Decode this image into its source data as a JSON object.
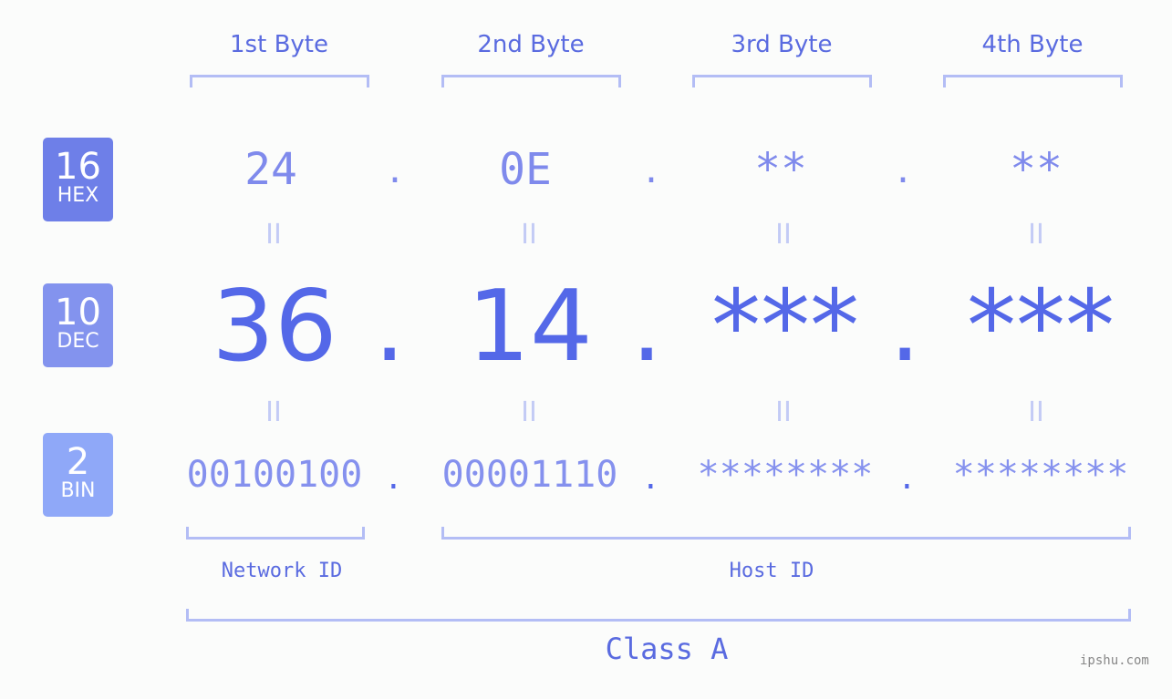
{
  "bytes": [
    {
      "header": "1st Byte",
      "hex": "24",
      "dec": "36",
      "bin": "00100100"
    },
    {
      "header": "2nd Byte",
      "hex": "0E",
      "dec": "14",
      "bin": "00001110"
    },
    {
      "header": "3rd Byte",
      "hex": "**",
      "dec": "***",
      "bin": "********"
    },
    {
      "header": "4th Byte",
      "hex": "**",
      "dec": "***",
      "bin": "********"
    }
  ],
  "bases": [
    {
      "num": "16",
      "label": "HEX",
      "color": "#6e7fe8"
    },
    {
      "num": "10",
      "label": "DEC",
      "color": "#8393ee"
    },
    {
      "num": "2",
      "label": "BIN",
      "color": "#8fa8f8"
    }
  ],
  "separator": ".",
  "equals": "II",
  "network_label": "Network ID",
  "host_label": "Host ID",
  "class_label": "Class A",
  "watermark": "ipshu.com"
}
